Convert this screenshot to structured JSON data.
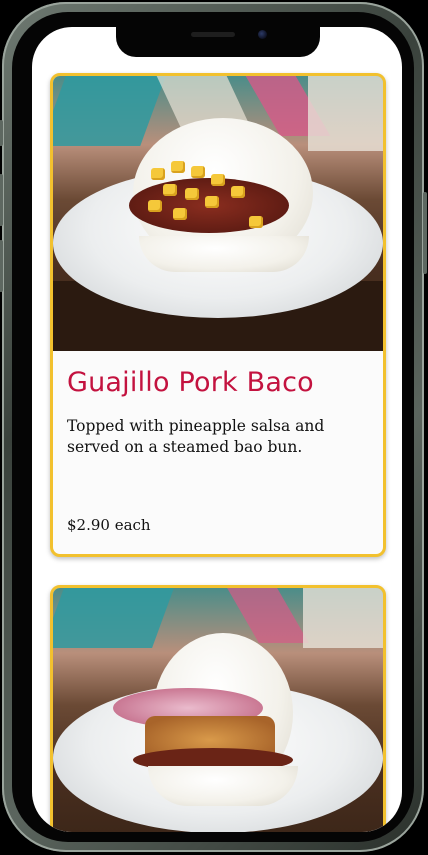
{
  "menu": {
    "items": [
      {
        "title": "Guajillo Pork Baco",
        "description": "Topped with pineapple salsa and served on a steamed bao bun.",
        "price": "$2.90 each"
      }
    ]
  },
  "colors": {
    "card_border": "#f2c12e",
    "title": "#c3123f"
  }
}
